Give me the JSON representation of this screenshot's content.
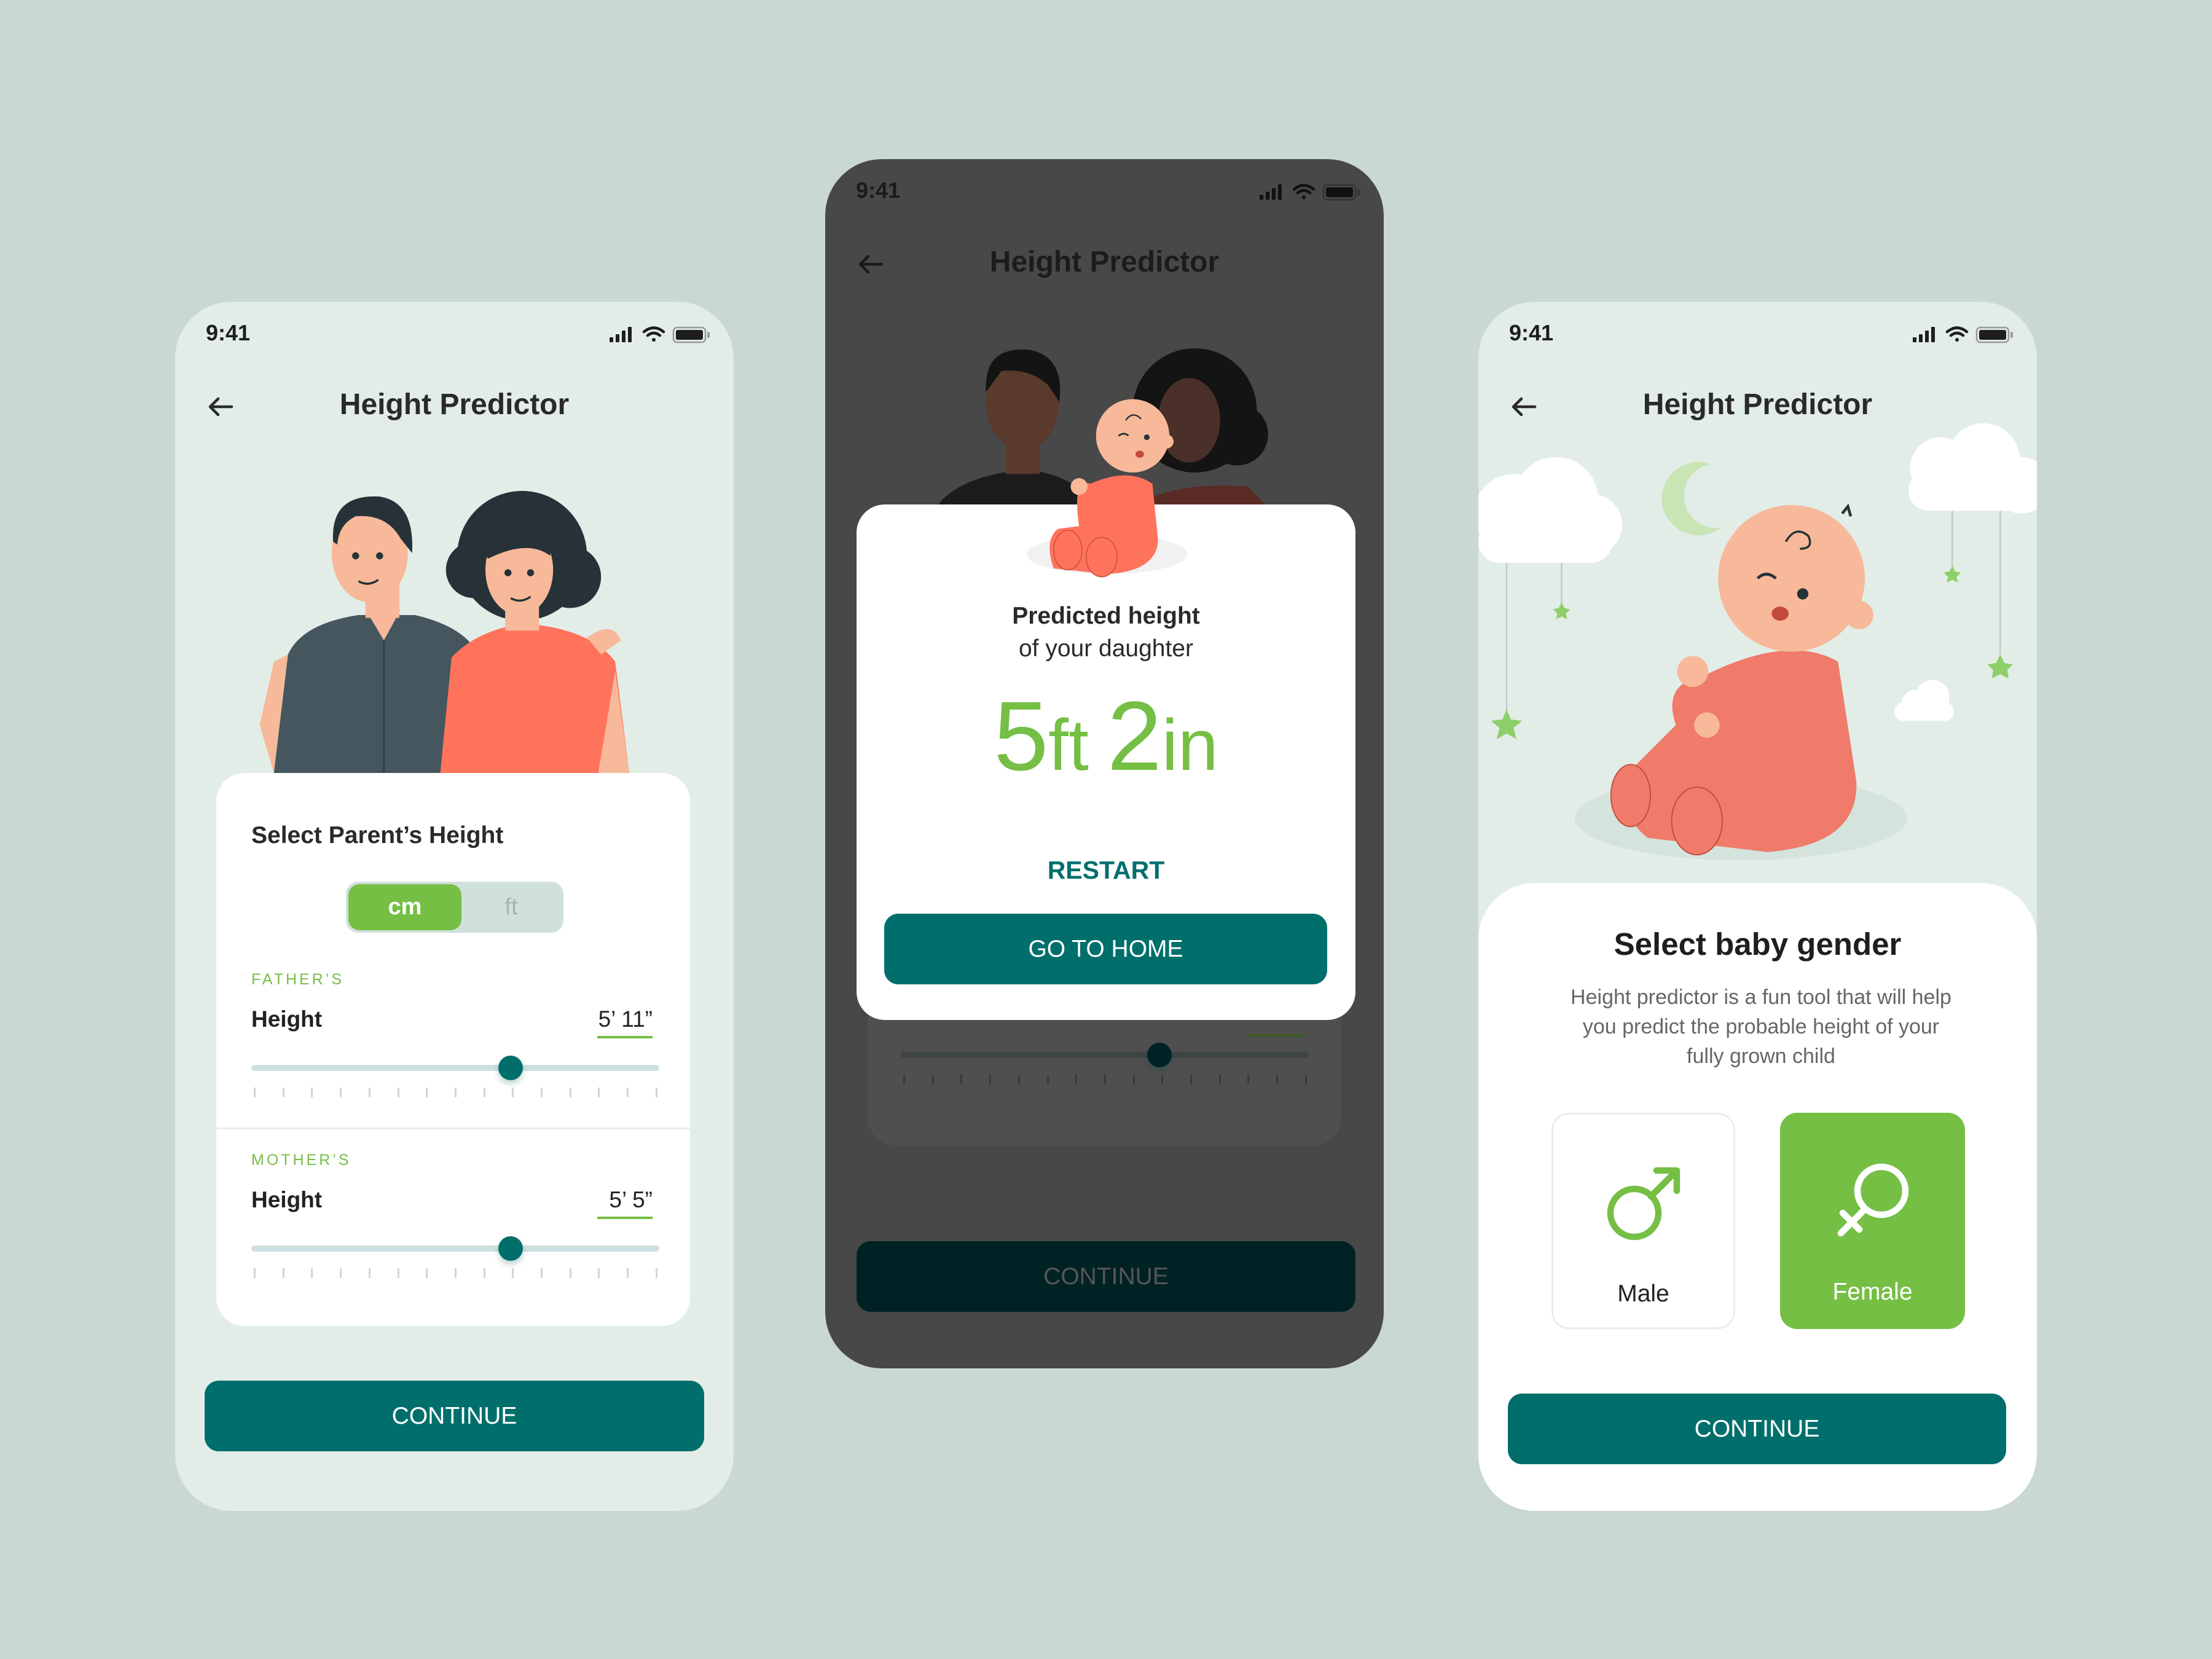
{
  "colors": {
    "background": "#c9d8d1",
    "phone_bg": "#e2ede7",
    "accent_green": "#75bf45",
    "primary_teal": "#006f6c",
    "dark_overlay": "#484848"
  },
  "status_bar": {
    "time": "9:41",
    "icons": [
      "signal-icon",
      "wifi-icon",
      "battery-icon"
    ]
  },
  "app_title": "Height Predictor",
  "screen1": {
    "card_title": "Select Parent’s Height",
    "units": [
      {
        "label": "cm",
        "selected": true
      },
      {
        "label": "ft",
        "selected": false
      }
    ],
    "father": {
      "section": "FATHER’S",
      "label": "Height",
      "value": "5’ 11”",
      "slider_level": 0.64
    },
    "mother": {
      "section": "MOTHER’S",
      "label": "Height",
      "value": "5’ 5”",
      "slider_level": 0.64
    },
    "continue": "CONTINUE"
  },
  "screen2": {
    "line1": "Predicted height",
    "line2": "of your daughter",
    "result": {
      "feet": "5",
      "feet_unit": "ft",
      "inches": "2",
      "inches_unit": "in"
    },
    "restart": "RESTART",
    "go_home": "GO TO HOME",
    "continue": "CONTINUE"
  },
  "screen3": {
    "heading": "Select baby gender",
    "description": "Height predictor is a fun tool that will help you predict the probable height of your fully grown child",
    "options": [
      {
        "label": "Male",
        "icon": "male-symbol-icon",
        "selected": false
      },
      {
        "label": "Female",
        "icon": "female-symbol-icon",
        "selected": true
      }
    ],
    "continue": "CONTINUE"
  }
}
